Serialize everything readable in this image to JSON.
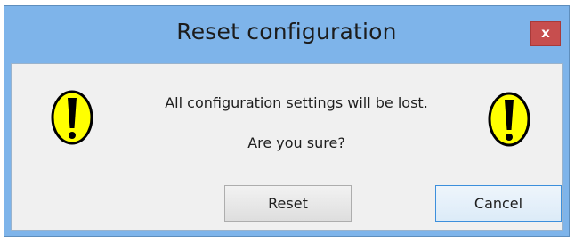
{
  "dialog": {
    "title": "Reset configuration",
    "close_label": "x",
    "message_line1": "All configuration settings will be lost.",
    "message_line2": "Are you sure?",
    "buttons": {
      "reset_label": "Reset",
      "cancel_label": "Cancel"
    },
    "icons": {
      "left": "warning-icon",
      "right": "warning-icon"
    }
  },
  "colors": {
    "frame": "#7eb4ea",
    "close_button": "#c74e4e",
    "content_bg": "#f0f0f0",
    "warning_fill": "#ffff00",
    "default_button_border": "#3c8fdc"
  }
}
